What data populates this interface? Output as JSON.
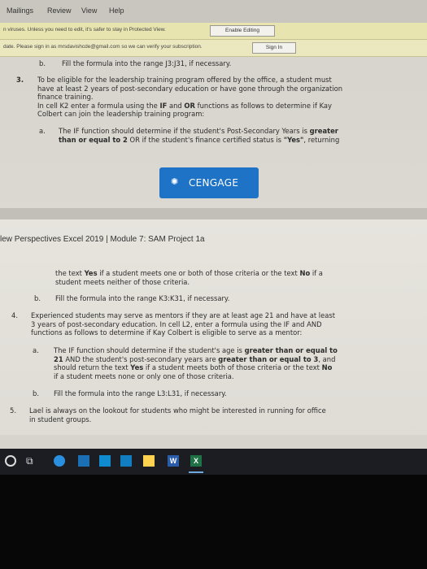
{
  "ribbon": {
    "tabs": [
      "Mailings",
      "Review",
      "View",
      "Help"
    ]
  },
  "protected_view": {
    "message": "n viruses. Unless you need to edit, it's safer to stay in Protected View.",
    "button": "Enable Editing"
  },
  "signin_bar": {
    "message": "date. Please sign in as mrsdavishcde@gmail.com so we can verify your subscription.",
    "button": "Sign In"
  },
  "page1": {
    "b_label": "b.",
    "b_text": "Fill the formula into the range J3:J31, if necessary.",
    "item3_num": "3.",
    "item3_l1": "To be eligible for the leadership training program offered by the office, a student must",
    "item3_l2": "have at least 2 years of post-secondary education or have gone through the organization",
    "item3_l3": "finance training.",
    "item3_l4a": "In cell K2 enter a formula using the ",
    "item3_l4b": "IF",
    "item3_l4c": " and ",
    "item3_l4d": "OR",
    "item3_l4e": " functions as follows to determine if Kay",
    "item3_l5": "Colbert can join the leadership training program:",
    "a_label": "a.",
    "a_l1a": "The IF function should determine if the student's Post-Secondary Years is ",
    "a_l1b": "greater",
    "a_l2a": "than or equal to 2",
    "a_l2b": " OR if the student's finance certified status is ",
    "a_l2c": "\"Yes\"",
    "a_l2d": ", returning"
  },
  "cengage": {
    "name": "CENGAGE"
  },
  "page2": {
    "header": "lew Perspectives Excel 2019 | Module 7: SAM Project 1a",
    "c_l1a": "the text ",
    "c_l1b": "Yes",
    "c_l1c": " if a student meets one or both of those criteria or the text ",
    "c_l1d": "No",
    "c_l1e": " if a",
    "c_l2": "student meets neither of those criteria.",
    "b_label": "b.",
    "b_text": "Fill the formula into the range K3:K31, if necessary.",
    "item4_num": "4.",
    "item4_l1": "Experienced students may serve as mentors if they are at least age 21 and have at least",
    "item4_l2": "3 years of post-secondary education. In cell L2, enter a formula using the IF and AND",
    "item4_l3": "functions as follows to determine if Kay Colbert is eligible to serve as a mentor:",
    "a_label": "a.",
    "a_l1a": "The IF function should determine if the student's age is ",
    "a_l1b": "greater than or equal to",
    "a_l2a": "21",
    "a_l2b": " AND the student's post-secondary years are ",
    "a_l2c": "greater than or equal to 3",
    "a_l2d": ", and",
    "a_l3a": "should return the text ",
    "a_l3b": "Yes",
    "a_l3c": " if a student meets both of those criteria or the text ",
    "a_l3d": "No",
    "a_l4": "if a student meets none or only one of those criteria.",
    "b2_label": "b.",
    "b2_text": "Fill the formula into the range L3:L31, if necessary.",
    "item5_num": "5.",
    "item5_l1": "Lael is always on the lookout for students who might be interested in running for office",
    "item5_l2": "in student groups."
  },
  "taskbar": {
    "icons": [
      "cortana-circle-icon",
      "task-view-icon",
      "edge-icon",
      "store-icon",
      "mail-icon",
      "word-icon",
      "excel-icon"
    ],
    "word_label": "W",
    "excel_label": "X"
  }
}
